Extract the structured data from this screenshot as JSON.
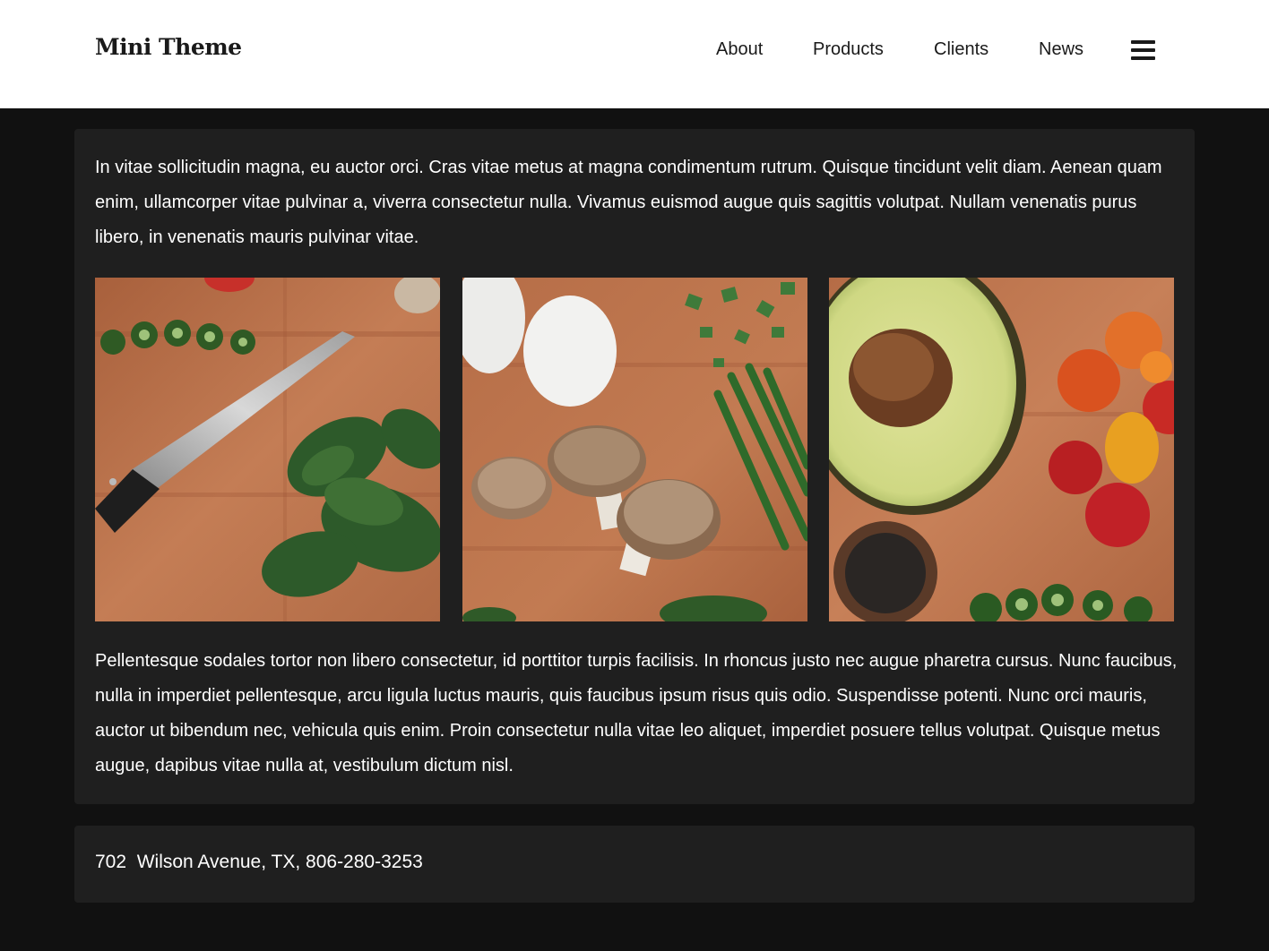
{
  "header": {
    "logo": "Mini Theme",
    "nav": {
      "about": "About",
      "products": "Products",
      "clients": "Clients",
      "news": "News"
    },
    "menu_icon": "hamburger-menu-icon"
  },
  "main": {
    "intro": "In vitae sollicitudin magna, eu auctor orci. Cras vitae metus at magna condimentum rutrum. Quisque tincidunt velit diam. Aenean quam enim, ullamcorper vitae pulvinar a, viverra consectetur nulla. Vivamus euismod augue quis sagittis volutpat. Nullam venenatis purus libero, in venenatis mauris pulvinar vitae.",
    "outro": "Pellentesque sodales tortor non libero consectetur, id porttitor turpis facilisis. In rhoncus justo nec augue pharetra cursus. Nunc faucibus, nulla in imperdiet pellentesque, arcu ligula luctus mauris, quis faucibus ipsum risus quis odio. Suspendisse potenti. Nunc orci mauris, auctor ut bibendum nec, vehicula quis enim. Proin consectetur nulla vitae leo aliquet, imperdiet posuere tellus volutpat. Quisque metus augue, dapibus vitae nulla at, vestibulum dictum nisl."
  },
  "footer": {
    "address": "702  Wilson Avenue, TX, 806-280-3253"
  },
  "colors": {
    "page_background": "#111111",
    "card_background": "#1f1f1f",
    "header_background": "#ffffff",
    "cutting_board": "#b06a45"
  }
}
